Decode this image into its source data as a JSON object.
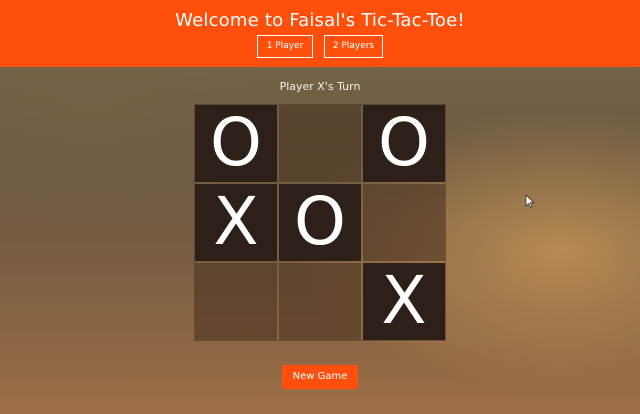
{
  "header": {
    "title": "Welcome to Faisal's Tic-Tac-Toe!",
    "buttons": [
      "1 Player",
      "2 Players"
    ]
  },
  "status": "Player X's Turn",
  "board": {
    "cells": [
      "O",
      "",
      "O",
      "X",
      "O",
      "",
      "",
      "",
      "X"
    ]
  },
  "new_game_label": "New Game",
  "colors": {
    "accent": "#ff4f0d",
    "filled_cell": "#2c2019",
    "text": "#ffffff"
  }
}
